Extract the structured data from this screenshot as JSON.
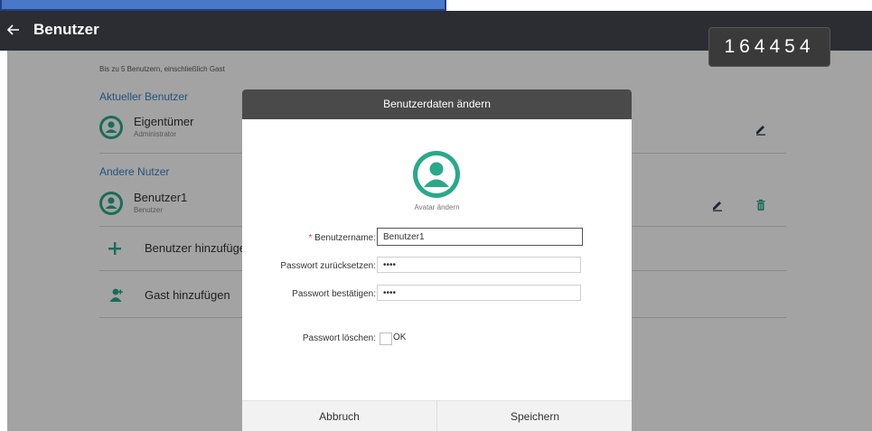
{
  "header": {
    "title": "Benutzer"
  },
  "badge": {
    "code": "164454"
  },
  "page": {
    "hint": "Bis zu 5 Benutzern, einschließlich Gast",
    "current_section": "Aktueller Benutzer",
    "current_user": {
      "name": "Eigentümer",
      "role": "Administrator"
    },
    "other_section": "Andere Nutzer",
    "other_user": {
      "name": "Benutzer1",
      "role": "Benutzer"
    },
    "add_user_label": "Benutzer hinzufügen",
    "add_guest_label": "Gast hinzufügen"
  },
  "dialog": {
    "title": "Benutzerdaten ändern",
    "avatar_caption": "Avatar ändern",
    "required_mark": "*",
    "username_label": "Benutzername:",
    "username_value": "Benutzer1",
    "reset_password_label": "Passwort zurücksetzen:",
    "reset_password_value": "••••",
    "confirm_password_label": "Passwort bestätigen:",
    "confirm_password_value": "••••",
    "delete_password_label": "Passwort löschen:",
    "delete_password_ok": "OK",
    "cancel_label": "Abbruch",
    "save_label": "Speichern"
  },
  "colors": {
    "accent": "#29a98a",
    "link": "#3b82c4",
    "header": "#2b2d33",
    "dialog_header": "#4a4a4a"
  }
}
